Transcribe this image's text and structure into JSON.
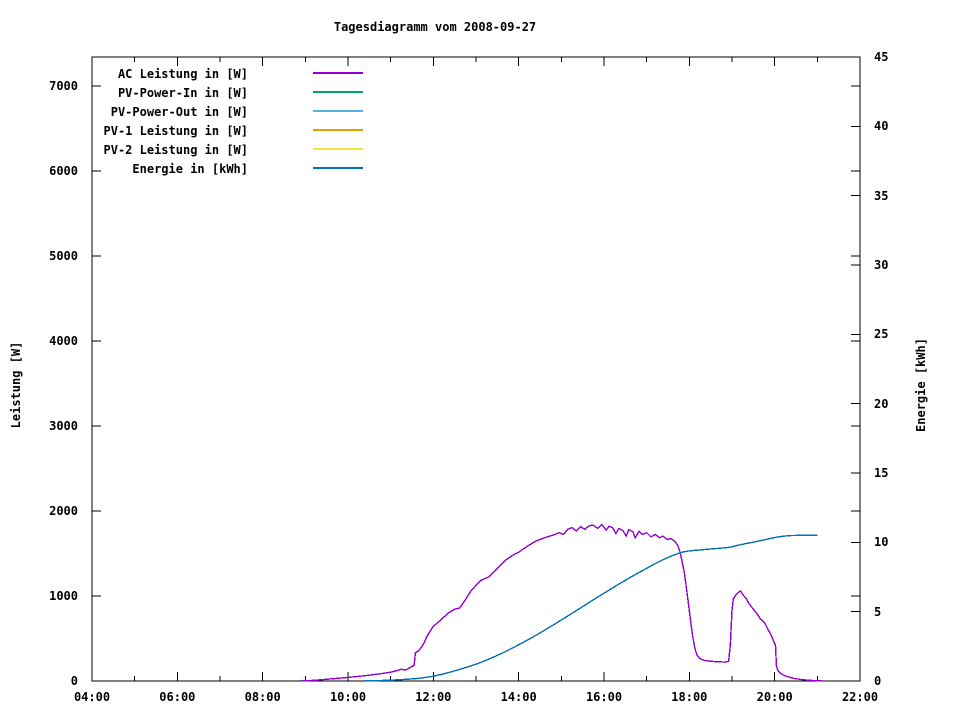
{
  "title": "Tagesdiagramm vom 2008-09-27",
  "axes": {
    "y_left": {
      "label": "Leistung [W]",
      "min": 0,
      "max": 7341,
      "ticks": [
        0,
        1000,
        2000,
        3000,
        4000,
        5000,
        6000,
        7000
      ]
    },
    "y_right": {
      "label": "Energie [kWh]",
      "min": 0,
      "max": 45,
      "ticks": [
        0,
        5,
        10,
        15,
        20,
        25,
        30,
        35,
        40,
        45
      ]
    },
    "x": {
      "min_hour": 4,
      "max_hour": 22,
      "tick_hours": [
        4,
        6,
        8,
        10,
        12,
        14,
        16,
        18,
        20,
        22
      ],
      "tick_labels": [
        "04:00",
        "06:00",
        "08:00",
        "10:00",
        "12:00",
        "14:00",
        "16:00",
        "18:00",
        "20:00",
        "22:00"
      ],
      "minor_hours": [
        5,
        7,
        9,
        11,
        13,
        15,
        17,
        19,
        21
      ]
    }
  },
  "chart_data": {
    "type": "line",
    "title": "Tagesdiagramm vom 2008-09-27",
    "x_unit": "time of day (hours)",
    "y_left_label": "Leistung [W]",
    "y_right_label": "Energie [kWh]",
    "x_range": [
      4,
      22
    ],
    "y_left_range": [
      0,
      7341
    ],
    "y_right_range": [
      0,
      45
    ],
    "grid": false,
    "legend_position": "top-left-inside",
    "series": [
      {
        "name": "AC Leistung in [W]",
        "color": "#9400d3",
        "axis": "left",
        "points": [
          [
            8.9,
            2
          ],
          [
            9.1,
            5
          ],
          [
            9.3,
            12
          ],
          [
            9.6,
            25
          ],
          [
            9.9,
            38
          ],
          [
            10.2,
            52
          ],
          [
            10.5,
            68
          ],
          [
            10.8,
            88
          ],
          [
            11.0,
            103
          ],
          [
            11.15,
            122
          ],
          [
            11.25,
            138
          ],
          [
            11.35,
            128
          ],
          [
            11.45,
            158
          ],
          [
            11.55,
            185
          ],
          [
            11.58,
            330
          ],
          [
            11.65,
            355
          ],
          [
            11.72,
            395
          ],
          [
            11.78,
            445
          ],
          [
            11.85,
            525
          ],
          [
            11.92,
            580
          ],
          [
            12.0,
            645
          ],
          [
            12.1,
            685
          ],
          [
            12.2,
            730
          ],
          [
            12.35,
            800
          ],
          [
            12.5,
            845
          ],
          [
            12.62,
            860
          ],
          [
            12.75,
            955
          ],
          [
            12.88,
            1060
          ],
          [
            13.0,
            1125
          ],
          [
            13.12,
            1185
          ],
          [
            13.3,
            1225
          ],
          [
            13.5,
            1325
          ],
          [
            13.7,
            1425
          ],
          [
            13.88,
            1485
          ],
          [
            14.0,
            1515
          ],
          [
            14.2,
            1585
          ],
          [
            14.4,
            1645
          ],
          [
            14.6,
            1685
          ],
          [
            14.8,
            1715
          ],
          [
            14.95,
            1745
          ],
          [
            15.05,
            1725
          ],
          [
            15.15,
            1785
          ],
          [
            15.25,
            1805
          ],
          [
            15.35,
            1765
          ],
          [
            15.45,
            1815
          ],
          [
            15.55,
            1785
          ],
          [
            15.65,
            1825
          ],
          [
            15.75,
            1835
          ],
          [
            15.85,
            1795
          ],
          [
            15.95,
            1840
          ],
          [
            16.05,
            1775
          ],
          [
            16.12,
            1820
          ],
          [
            16.2,
            1805
          ],
          [
            16.28,
            1735
          ],
          [
            16.35,
            1795
          ],
          [
            16.45,
            1765
          ],
          [
            16.52,
            1705
          ],
          [
            16.58,
            1780
          ],
          [
            16.68,
            1755
          ],
          [
            16.73,
            1685
          ],
          [
            16.82,
            1760
          ],
          [
            16.9,
            1725
          ],
          [
            17.0,
            1745
          ],
          [
            17.1,
            1695
          ],
          [
            17.2,
            1725
          ],
          [
            17.3,
            1685
          ],
          [
            17.38,
            1705
          ],
          [
            17.48,
            1665
          ],
          [
            17.58,
            1675
          ],
          [
            17.65,
            1645
          ],
          [
            17.72,
            1605
          ],
          [
            17.78,
            1525
          ],
          [
            17.83,
            1405
          ],
          [
            17.88,
            1285
          ],
          [
            17.93,
            1105
          ],
          [
            17.98,
            905
          ],
          [
            18.03,
            705
          ],
          [
            18.08,
            525
          ],
          [
            18.13,
            385
          ],
          [
            18.18,
            305
          ],
          [
            18.25,
            262
          ],
          [
            18.35,
            242
          ],
          [
            18.5,
            232
          ],
          [
            18.68,
            226
          ],
          [
            18.85,
            222
          ],
          [
            18.92,
            232
          ],
          [
            18.96,
            420
          ],
          [
            19.0,
            830
          ],
          [
            19.03,
            965
          ],
          [
            19.08,
            1005
          ],
          [
            19.14,
            1040
          ],
          [
            19.2,
            1058
          ],
          [
            19.26,
            1012
          ],
          [
            19.33,
            972
          ],
          [
            19.4,
            908
          ],
          [
            19.46,
            872
          ],
          [
            19.52,
            832
          ],
          [
            19.6,
            782
          ],
          [
            19.66,
            732
          ],
          [
            19.72,
            706
          ],
          [
            19.78,
            672
          ],
          [
            19.84,
            612
          ],
          [
            19.9,
            556
          ],
          [
            19.95,
            502
          ],
          [
            19.99,
            452
          ],
          [
            20.02,
            420
          ],
          [
            20.04,
            180
          ],
          [
            20.07,
            128
          ],
          [
            20.12,
            96
          ],
          [
            20.18,
            76
          ],
          [
            20.26,
            58
          ],
          [
            20.36,
            42
          ],
          [
            20.5,
            26
          ],
          [
            20.65,
            15
          ],
          [
            20.82,
            8
          ],
          [
            21.0,
            4
          ],
          [
            21.12,
            2
          ]
        ]
      },
      {
        "name": "PV-Power-In in [W]",
        "color": "#009e73",
        "axis": "left",
        "points": []
      },
      {
        "name": "PV-Power-Out in [W]",
        "color": "#56b4e9",
        "axis": "left",
        "points": []
      },
      {
        "name": "PV-1 Leistung in [W]",
        "color": "#e69f00",
        "axis": "left",
        "points": []
      },
      {
        "name": "PV-2 Leistung in [W]",
        "color": "#f0e442",
        "axis": "left",
        "points": []
      },
      {
        "name": "Energie in [kWh]",
        "color": "#0072b2",
        "axis": "right",
        "points": [
          [
            10.4,
            0.01
          ],
          [
            10.7,
            0.03
          ],
          [
            11.0,
            0.06
          ],
          [
            11.3,
            0.11
          ],
          [
            11.6,
            0.17
          ],
          [
            11.8,
            0.25
          ],
          [
            12.0,
            0.34
          ],
          [
            12.2,
            0.48
          ],
          [
            12.4,
            0.64
          ],
          [
            12.6,
            0.82
          ],
          [
            12.8,
            1.01
          ],
          [
            13.0,
            1.21
          ],
          [
            13.2,
            1.45
          ],
          [
            13.4,
            1.71
          ],
          [
            13.6,
            1.99
          ],
          [
            13.8,
            2.29
          ],
          [
            14.0,
            2.61
          ],
          [
            14.2,
            2.94
          ],
          [
            14.4,
            3.29
          ],
          [
            14.6,
            3.65
          ],
          [
            14.8,
            4.02
          ],
          [
            15.0,
            4.4
          ],
          [
            15.2,
            4.78
          ],
          [
            15.4,
            5.17
          ],
          [
            15.6,
            5.56
          ],
          [
            15.8,
            5.95
          ],
          [
            16.0,
            6.33
          ],
          [
            16.2,
            6.71
          ],
          [
            16.4,
            7.08
          ],
          [
            16.6,
            7.44
          ],
          [
            16.8,
            7.79
          ],
          [
            17.0,
            8.13
          ],
          [
            17.2,
            8.46
          ],
          [
            17.4,
            8.77
          ],
          [
            17.6,
            9.04
          ],
          [
            17.75,
            9.21
          ],
          [
            17.85,
            9.3
          ],
          [
            17.95,
            9.36
          ],
          [
            18.1,
            9.41
          ],
          [
            18.3,
            9.47
          ],
          [
            18.5,
            9.52
          ],
          [
            18.7,
            9.57
          ],
          [
            18.9,
            9.63
          ],
          [
            19.0,
            9.68
          ],
          [
            19.1,
            9.76
          ],
          [
            19.2,
            9.83
          ],
          [
            19.35,
            9.92
          ],
          [
            19.5,
            10.01
          ],
          [
            19.65,
            10.11
          ],
          [
            19.8,
            10.21
          ],
          [
            19.95,
            10.31
          ],
          [
            20.1,
            10.4
          ],
          [
            20.25,
            10.46
          ],
          [
            20.4,
            10.49
          ],
          [
            20.6,
            10.5
          ],
          [
            20.8,
            10.5
          ],
          [
            21.0,
            10.5
          ]
        ]
      }
    ]
  }
}
